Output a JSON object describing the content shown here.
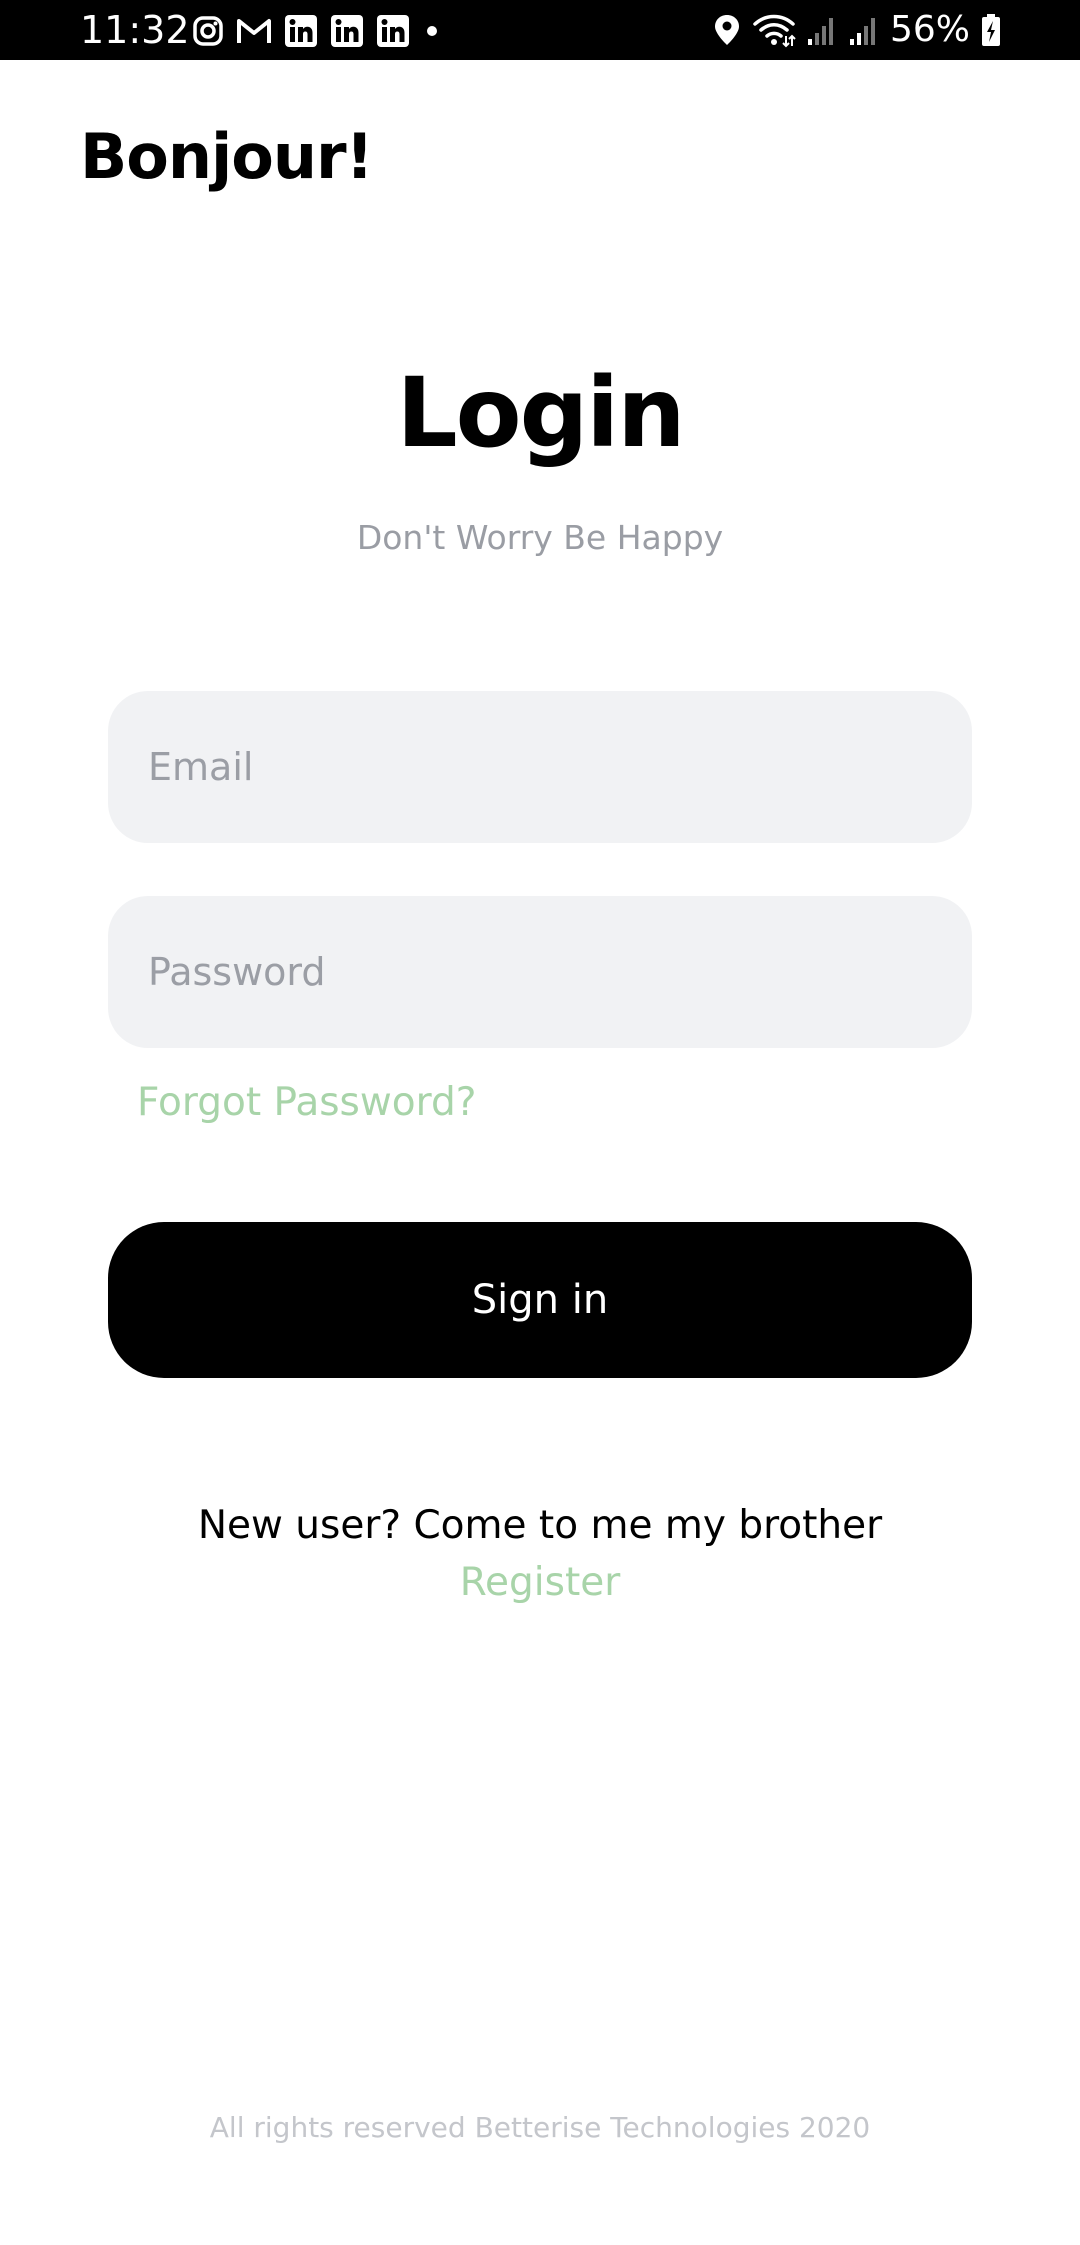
{
  "status_bar": {
    "time": "11:32",
    "battery_percent": "56%",
    "notification_icons": [
      "instagram-icon",
      "gmail-icon",
      "linkedin-icon",
      "linkedin-icon",
      "linkedin-icon",
      "dot-icon"
    ],
    "system_icons": [
      "location-icon",
      "wifi-icon",
      "signal-icon",
      "signal-icon",
      "battery-icon"
    ]
  },
  "header": {
    "greeting": "Bonjour!"
  },
  "login": {
    "title": "Login",
    "subtitle": "Don't Worry Be Happy",
    "email_placeholder": "Email",
    "email_value": "",
    "password_placeholder": "Password",
    "password_value": "",
    "forgot_label": "Forgot Password?",
    "signin_label": "Sign in"
  },
  "register": {
    "prompt": "New user? Come to me my brother",
    "link_label": "Register"
  },
  "footer": {
    "text": "All rights reserved Betterise Technologies 2020"
  },
  "colors": {
    "accent_green": "#a8d4a9",
    "input_bg": "#f1f2f4",
    "button_bg": "#000000",
    "muted_text": "#9a9da4"
  }
}
